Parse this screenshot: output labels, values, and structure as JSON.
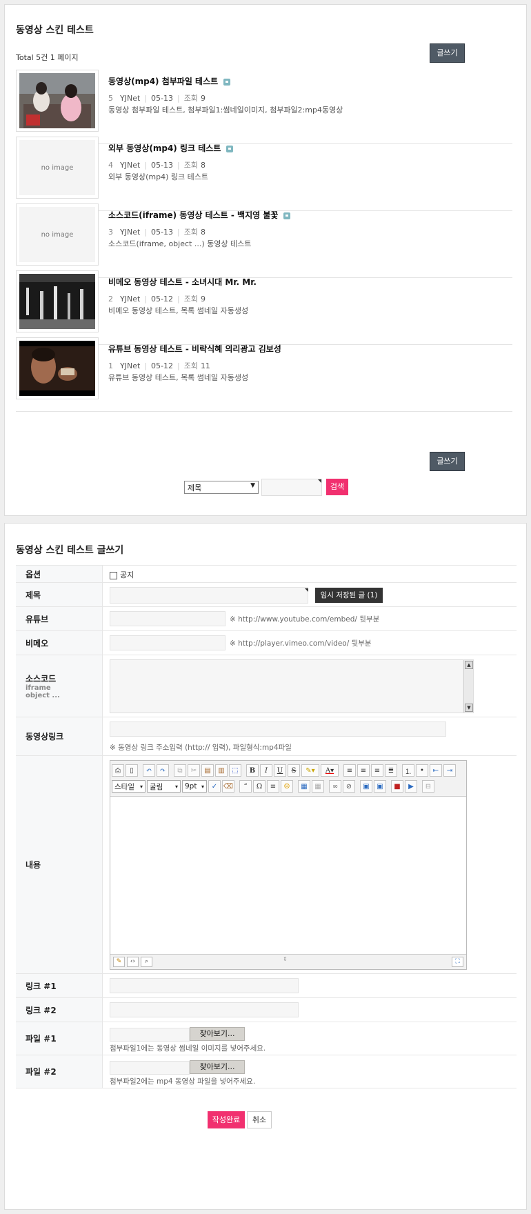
{
  "list": {
    "title": "동영상 스킨 테스트",
    "total": "Total 5건 1 페이지",
    "write_label": "글쓰기",
    "items": [
      {
        "num": "5",
        "title": "동영상(mp4) 첨부파일 테스트",
        "author": "YJNet",
        "date": "05-13",
        "views_label": "조회",
        "views": "9",
        "desc": "동영상 첨부파일 테스트, 첨부파일1:썸네일이미지, 첨부파일2:mp4동영상",
        "thumb": "photo",
        "has_comment": true
      },
      {
        "num": "4",
        "title": "외부 동영상(mp4) 링크 테스트",
        "author": "YJNet",
        "date": "05-13",
        "views_label": "조회",
        "views": "8",
        "desc": "외부 동영상(mp4) 링크 테스트",
        "thumb": "no image",
        "has_comment": true
      },
      {
        "num": "3",
        "title": "소스코드(iframe) 동영상 테스트 - 백지영 불꽃",
        "author": "YJNet",
        "date": "05-13",
        "views_label": "조회",
        "views": "8",
        "desc": "소스코드(iframe, object ...) 동영상 테스트",
        "thumb": "no image",
        "has_comment": true
      },
      {
        "num": "2",
        "title": "비메오 동영상 테스트 - 소녀시대 Mr. Mr.",
        "author": "YJNet",
        "date": "05-12",
        "views_label": "조회",
        "views": "9",
        "desc": "비메오 동영상 테스트, 목록 썸네일 자동생성",
        "thumb": "photo",
        "has_comment": false
      },
      {
        "num": "1",
        "title": "유튜브 동영상 테스트 - 비락식혜 의리광고 김보성",
        "author": "YJNet",
        "date": "05-12",
        "views_label": "조회",
        "views": "11",
        "desc": "유튜브 동영상 테스트, 목록 썸네일 자동생성",
        "thumb": "photo",
        "has_comment": false
      }
    ],
    "search": {
      "select_value": "제목",
      "button_label": "검색"
    }
  },
  "write": {
    "title": "동영상 스킨 테스트 글쓰기",
    "option_label": "옵션",
    "notice_label": "공지",
    "subject_label": "제목",
    "temp_saved_label": "임시 저장된 글 (1)",
    "youtube_label": "유튜브",
    "youtube_hint": "※ http://www.youtube.com/embed/ 뒷부분",
    "vimeo_label": "비메오",
    "vimeo_hint": "※ http://player.vimeo.com/video/ 뒷부분",
    "source_label": "소스코드",
    "source_sub1": "iframe",
    "source_sub2": "object ...",
    "videolink_label": "동영상링크",
    "videolink_hint": "※ 동영상 링크 주소입력 (http:// 입력), 파일형식:mp4파일",
    "content_label": "내용",
    "editor": {
      "style_label": "스타일",
      "font_label": "굴림",
      "size_label": "9pt"
    },
    "link1_label": "링크 #1",
    "link2_label": "링크 #2",
    "file1_label": "파일 #1",
    "file1_button": "찾아보기...",
    "file1_hint": "첨부파일1에는 동영상 썸네일 이미지를 넣어주세요.",
    "file2_label": "파일 #2",
    "file2_button": "찾아보기...",
    "file2_hint": "첨부파일2에는 mp4 동영상 파일을 넣어주세요.",
    "submit_label": "작성완료",
    "cancel_label": "취소"
  }
}
